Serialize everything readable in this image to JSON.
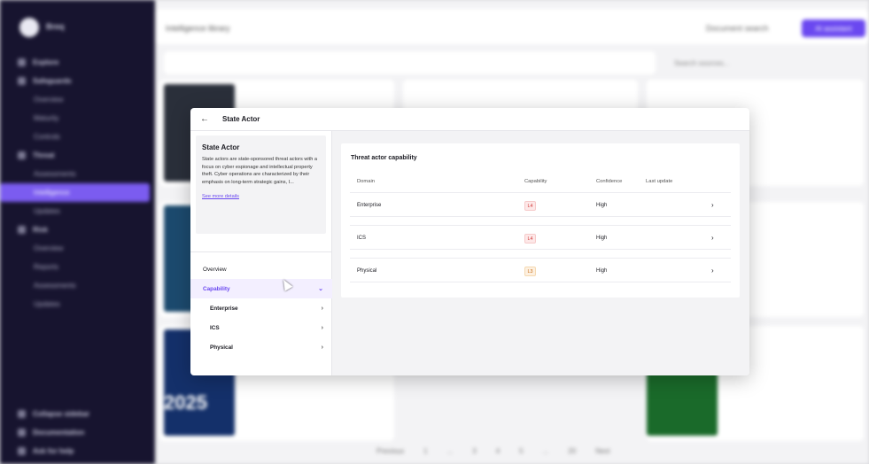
{
  "background": {
    "logo_text": "Breq",
    "nav": [
      "Explore",
      "Safeguards",
      "Overview",
      "Maturity",
      "Controls",
      "Threat",
      "Assessments",
      "Intelligence",
      "Updates",
      "Risk",
      "Overview",
      "Reports",
      "Assessments",
      "Updates"
    ],
    "nav_bottom": [
      "Collapse sidebar",
      "Documentation",
      "Ask for help"
    ],
    "topbar_title": "Intelligence library",
    "doc_search": "Document search",
    "ai_button": "AI assistant",
    "search_sources": "Search sources...",
    "cover_year": "2025",
    "pager": [
      "Previous",
      "1",
      "...",
      "3",
      "4",
      "5",
      "...",
      "20",
      "Next"
    ]
  },
  "modal": {
    "back_icon": "arrow-left-icon",
    "title": "State Actor",
    "info": {
      "title": "State Actor",
      "text": "State actors are state-sponsored threat actors with a focus on cyber espionage and intellectual property theft. Cyber operations are characterized by their emphasis on long-term strategic gains, I...",
      "link": "See more details"
    },
    "nav": {
      "overview": "Overview",
      "capability": "Capability",
      "sub": [
        "Enterprise",
        "ICS",
        "Physical"
      ]
    },
    "capability": {
      "title": "Threat actor capability",
      "headers": {
        "domain": "Domain",
        "capability": "Capability",
        "confidence": "Confidence",
        "last_update": "Last update"
      },
      "rows": [
        {
          "domain": "Enterprise",
          "level": "L4",
          "confidence": "High",
          "last_update": ""
        },
        {
          "domain": "ICS",
          "level": "L4",
          "confidence": "High",
          "last_update": ""
        },
        {
          "domain": "Physical",
          "level": "L3",
          "confidence": "High",
          "last_update": ""
        }
      ]
    }
  },
  "colors": {
    "accent": "#6a48f0",
    "sidebar": "#17142f",
    "level_high": "#d23a3a",
    "level_medium": "#c66a14"
  }
}
